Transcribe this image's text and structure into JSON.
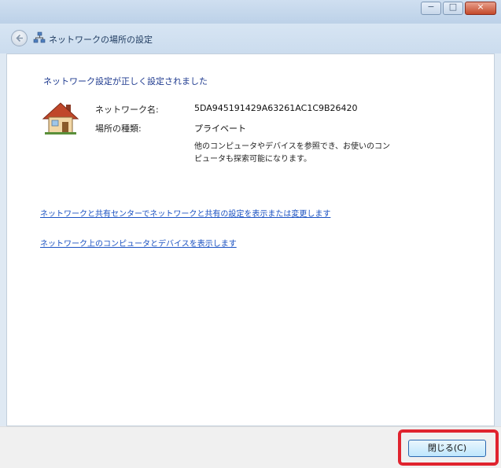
{
  "window": {
    "caption": {
      "minimize": "−",
      "maximize": "□",
      "close": "×"
    }
  },
  "nav": {
    "title": "ネットワークの場所の設定"
  },
  "main": {
    "instruction": "ネットワーク設定が正しく設定されました",
    "network_name_label": "ネットワーク名:",
    "network_name_value": "5DA945191429A63261AC1C9B26420",
    "location_type_label": "場所の種類:",
    "location_type_value": "プライベート",
    "location_description": "他のコンピュータやデバイスを参照でき、お使いのコンピュータも探索可能になります。",
    "link_sharing_center": "ネットワークと共有センターでネットワークと共有の設定を表示または変更します",
    "link_view_computers": "ネットワーク上のコンピュータとデバイスを表示します"
  },
  "footer": {
    "close_label": "閉じる(C)"
  },
  "colors": {
    "highlight": "#e0232e",
    "link": "#1b52c2",
    "instruction": "#1e3a8f"
  }
}
